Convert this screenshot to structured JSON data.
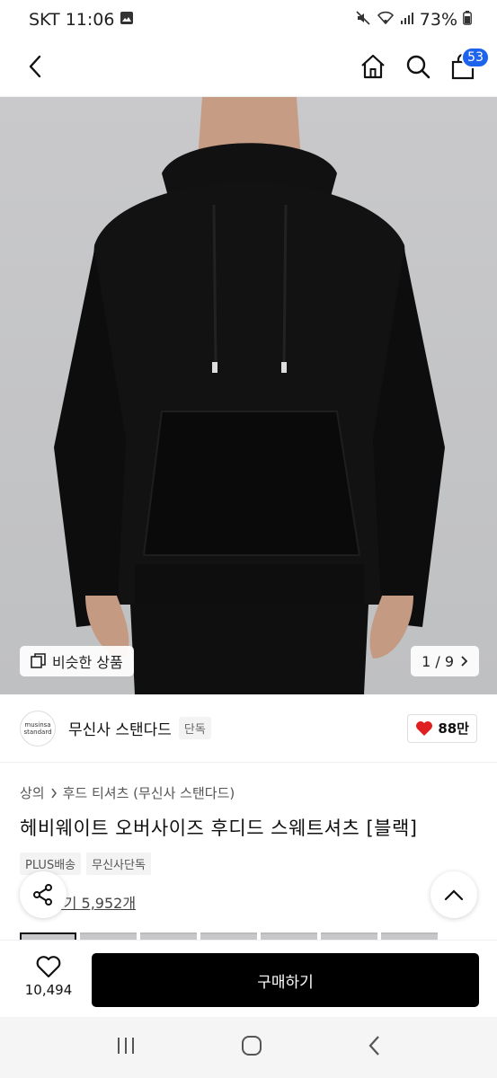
{
  "status": {
    "carrier_time": "SKT 11:06",
    "battery": "73%"
  },
  "header": {
    "cart_count": "53"
  },
  "hero": {
    "similar_label": "비슷한 상품",
    "page_counter": "1 / 9"
  },
  "brand": {
    "logo_line1": "musinsa",
    "logo_line2": "standard",
    "name": "무신사 스탠다드",
    "tag": "단독",
    "likes": "88만"
  },
  "product": {
    "breadcrumb_category": "상의",
    "breadcrumb_sub": "후드 티셔츠 (무신사 스탠다드)",
    "title": "헤비웨이트 오버사이즈 후디드 스웨트셔츠 [블랙]",
    "tags": [
      "PLUS배송",
      "무신사단독"
    ],
    "reviews": "후기 5,952개"
  },
  "bottom": {
    "wish_count": "10,494",
    "buy_label": "구매하기"
  },
  "colors": {
    "accent": "#1d63ed",
    "heart": "#e02020",
    "buy_bg": "#000000"
  }
}
